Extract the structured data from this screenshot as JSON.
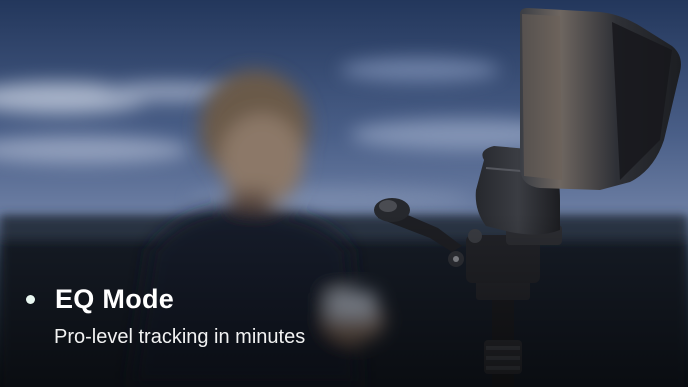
{
  "caption": {
    "title": "EQ Mode",
    "subtitle": "Pro-level tracking in minutes"
  },
  "colors": {
    "sky_top": "#2a3f66",
    "sky_mid": "#5c7099",
    "horizon": "#2b3646",
    "ground": "#141a22",
    "text": "#ffffff"
  }
}
